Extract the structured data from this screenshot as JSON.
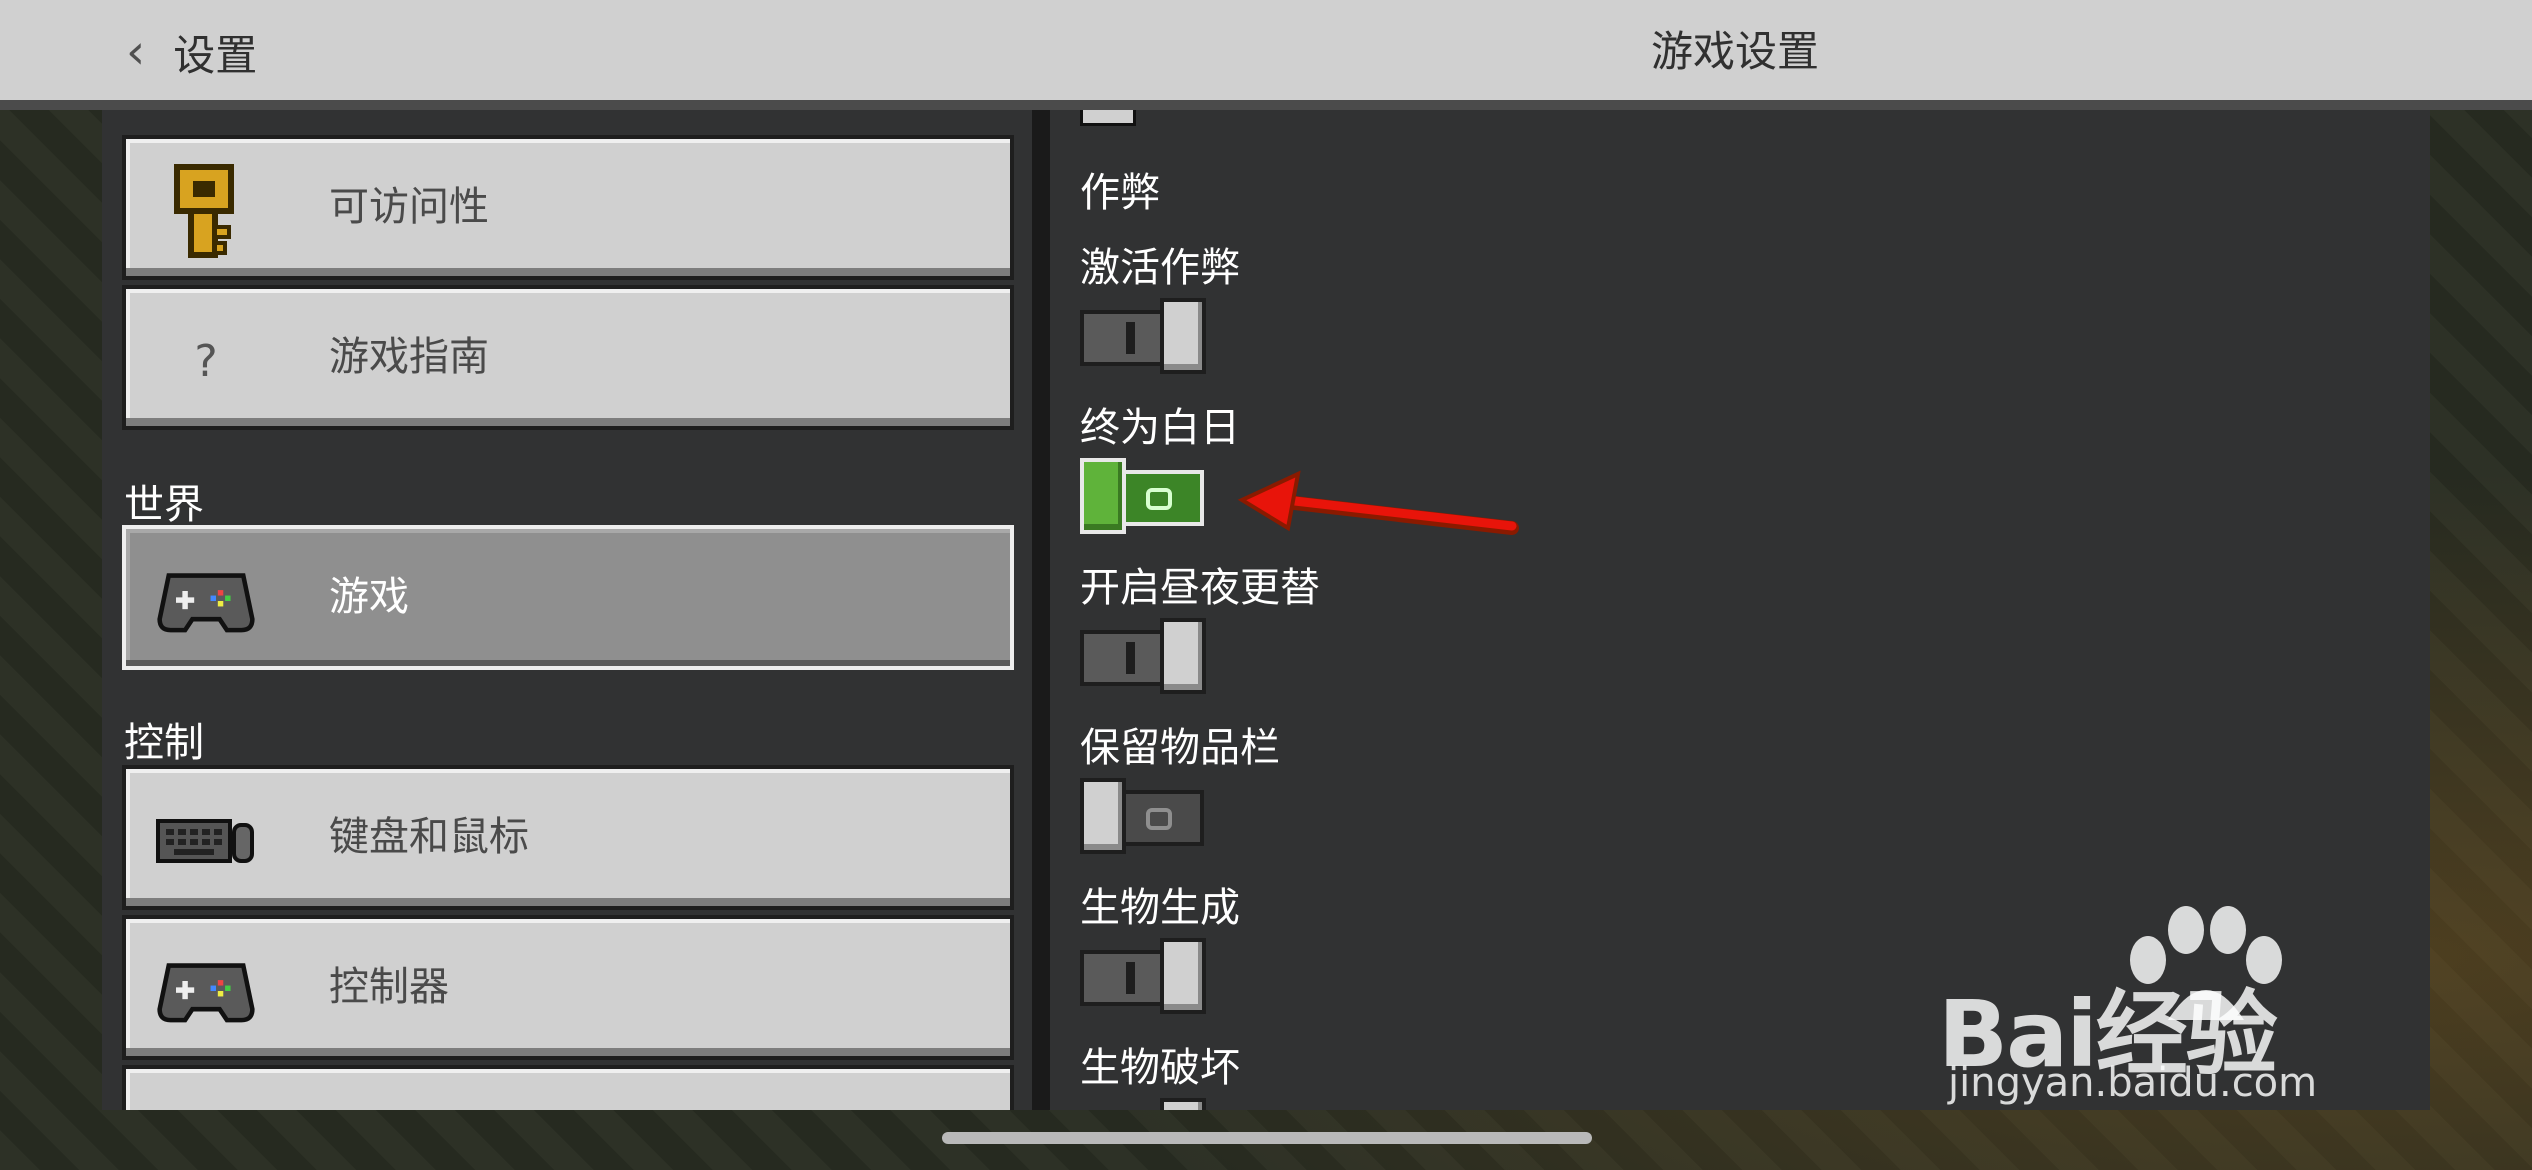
{
  "header": {
    "back_label": "设置",
    "title": "游戏设置"
  },
  "sidebar": {
    "items_top": [
      {
        "label": "可访问性",
        "icon": "key-icon"
      },
      {
        "label": "游戏指南",
        "icon": "question-icon",
        "glyph": "?"
      }
    ],
    "section_world": "世界",
    "world_items": [
      {
        "label": "游戏",
        "icon": "gamepad-icon",
        "selected": true
      }
    ],
    "section_controls": "控制",
    "controls_items": [
      {
        "label": "键盘和鼠标",
        "icon": "keyboard-mouse-icon"
      },
      {
        "label": "控制器",
        "icon": "controller-icon"
      }
    ]
  },
  "settings": {
    "section_cheats": "作弊",
    "toggles": [
      {
        "label": "激活作弊",
        "state": "off"
      },
      {
        "label": "终为白日",
        "state": "on"
      },
      {
        "label": "开启昼夜更替",
        "state": "off"
      },
      {
        "label": "保留物品栏",
        "state": "off-alt"
      },
      {
        "label": "生物生成",
        "state": "off"
      },
      {
        "label": "生物破坏",
        "state": "off"
      }
    ]
  },
  "watermark": {
    "logo_text": "Bai经验",
    "url": "jingyan.baidu.com"
  },
  "colors": {
    "arrow": "#e8140a",
    "toggle_on": "#3c8527"
  }
}
